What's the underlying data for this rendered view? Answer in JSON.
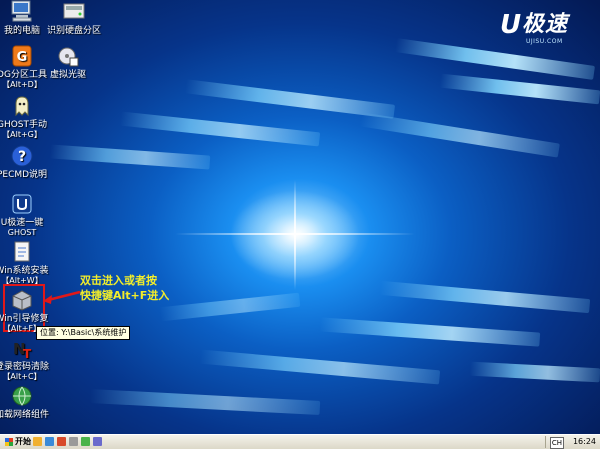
{
  "brand": {
    "letter": "U",
    "name": "极速",
    "url": "UJISU.COM"
  },
  "desktop_icons": [
    {
      "label": "我的电脑",
      "sub": ""
    },
    {
      "label": "识别硬盘分区",
      "sub": ""
    },
    {
      "label": "DG分区工具",
      "sub": "【Alt+D】"
    },
    {
      "label": "虚拟光驱",
      "sub": ""
    },
    {
      "label": "GHOST手动",
      "sub": "【Alt+G】"
    },
    {
      "label": "PECMD说明",
      "sub": ""
    },
    {
      "label": "U极速一键",
      "sub": "GHOST"
    },
    {
      "label": "Win系统安装",
      "sub": "【Alt+W】"
    },
    {
      "label": "Win引导修复",
      "sub": "【Alt+F】"
    },
    {
      "label": "登录密码清除",
      "sub": "【Alt+C】"
    },
    {
      "label": "加载网络组件",
      "sub": ""
    }
  ],
  "tooltip": "位置: Y:\\Basic\\系统维护",
  "annotation": {
    "line1": "双击进入或者按",
    "line2": "快捷键Alt+F进入"
  },
  "taskbar": {
    "start_label": "开始",
    "ime": "CH",
    "clock": "16:24"
  },
  "colors": {
    "annotation": "#f3ee2a",
    "highlight_box": "#e01818",
    "arrow": "#e01818"
  }
}
